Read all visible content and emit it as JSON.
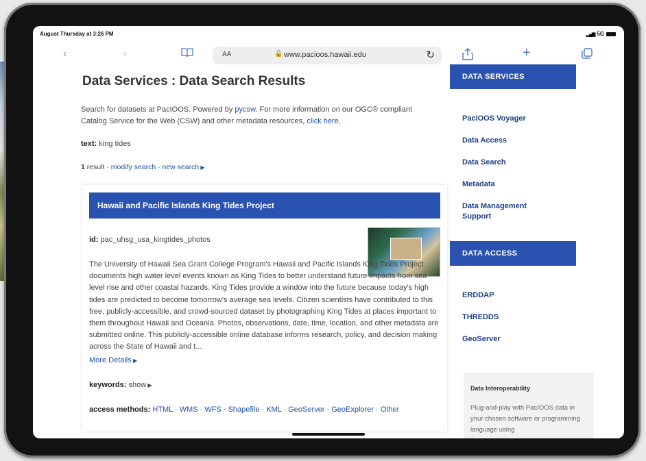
{
  "status": {
    "time": "August Thursday at 3:26 PM",
    "network": "5G"
  },
  "browser": {
    "reader_size": "AA",
    "url": "www.pacioos.hawaii.edu"
  },
  "page": {
    "title": "Data Services : Data Search Results",
    "intro_part1": "Search for datasets at PacIOOS. Powered by ",
    "intro_link1": "pycsw",
    "intro_part2": ". For more information on our OGC® compliant Catalog Service for the Web (CSW) and other metadata resources, ",
    "intro_link2": "click here",
    "intro_part3": ".",
    "query_label": "text:",
    "query_value": "king tides",
    "result_count": "1",
    "result_word": "result",
    "modify_search": "modify search",
    "new_search": "new search"
  },
  "result": {
    "title": "Hawaii and Pacific Islands King Tides Project",
    "id_label": "id:",
    "id_value": "pac_uhsg_usa_kingtides_photos",
    "description": "The University of Hawaii Sea Grant College Program's Hawaii and Pacific Islands King Tides Project documents high water level events known as King Tides to better understand future impacts from sea level rise and other coastal hazards. King Tides provide a window into the future because today's high tides are predicted to become tomorrow's average sea levels. Citizen scientists have contributed to this free, publicly-accessible, and crowd-sourced dataset by photographing King Tides at places important to them throughout Hawaii and Oceania. Photos, observations, date, time, location, and other metadata are submitted online. This publicly-accessible online database informs research, policy, and decision making across the State of Hawaii and t...",
    "more_details": "More Details",
    "keywords_label": "keywords:",
    "keywords_show": "show",
    "access_label": "access methods:",
    "access_methods": [
      "HTML",
      "WMS",
      "WFS",
      "Shapefile",
      "KML",
      "GeoServer",
      "GeoExplorer",
      "Other"
    ]
  },
  "sidebar": {
    "data_services_heading": "DATA SERVICES",
    "data_services_links": [
      "PacIOOS Voyager",
      "Data Access",
      "Data Search",
      "Metadata",
      "Data Management Support"
    ],
    "data_access_heading": "DATA ACCESS",
    "data_access_links": [
      "ERDDAP",
      "THREDDS",
      "GeoServer"
    ],
    "interop_title": "Data Interoperability",
    "interop_text": "Plug-and-play with PacIOOS data in your chosen software or programming language using"
  },
  "colors": {
    "accent": "#2a52b0",
    "link": "#1f4fa8",
    "sidebar_link": "#1f3f86"
  }
}
